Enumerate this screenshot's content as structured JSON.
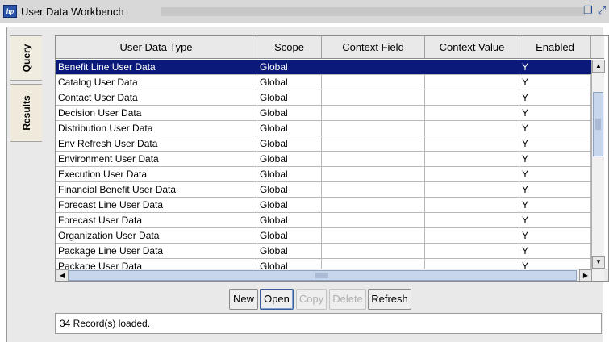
{
  "window": {
    "title": "User Data Workbench",
    "logo_text": "hp"
  },
  "tabs": [
    "Query",
    "Results"
  ],
  "table": {
    "columns": [
      "User Data Type",
      "Scope",
      "Context Field",
      "Context Value",
      "Enabled"
    ],
    "rows": [
      [
        "Benefit Line User Data",
        "Global",
        "",
        "",
        "Y"
      ],
      [
        "Catalog User Data",
        "Global",
        "",
        "",
        "Y"
      ],
      [
        "Contact User Data",
        "Global",
        "",
        "",
        "Y"
      ],
      [
        "Decision User Data",
        "Global",
        "",
        "",
        "Y"
      ],
      [
        "Distribution User Data",
        "Global",
        "",
        "",
        "Y"
      ],
      [
        "Env Refresh User Data",
        "Global",
        "",
        "",
        "Y"
      ],
      [
        "Environment User Data",
        "Global",
        "",
        "",
        "Y"
      ],
      [
        "Execution User Data",
        "Global",
        "",
        "",
        "Y"
      ],
      [
        "Financial Benefit User Data",
        "Global",
        "",
        "",
        "Y"
      ],
      [
        "Forecast Line User Data",
        "Global",
        "",
        "",
        "Y"
      ],
      [
        "Forecast User Data",
        "Global",
        "",
        "",
        "Y"
      ],
      [
        "Organization User Data",
        "Global",
        "",
        "",
        "Y"
      ],
      [
        "Package Line User Data",
        "Global",
        "",
        "",
        "Y"
      ],
      [
        "Package User Data",
        "Global",
        "",
        "",
        "Y"
      ]
    ],
    "selected_row": 0
  },
  "buttons": {
    "new": "New",
    "open": "Open",
    "copy": "Copy",
    "delete": "Delete",
    "refresh": "Refresh"
  },
  "status": {
    "text": "34 Record(s) loaded."
  },
  "colors": {
    "selection": "#0b1a7a",
    "frame": "#e9e9e9"
  }
}
